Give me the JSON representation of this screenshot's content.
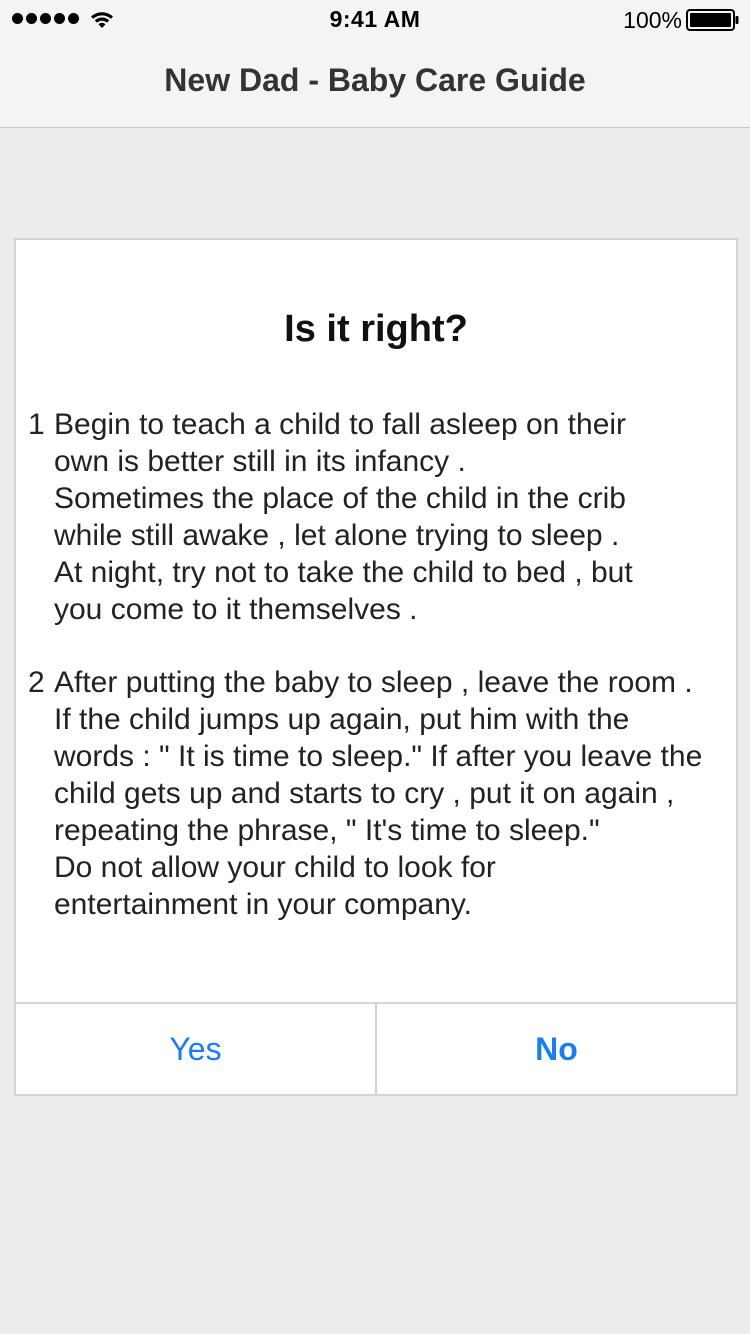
{
  "status_bar": {
    "time": "9:41 AM",
    "battery": "100%",
    "signal_icon": "signal-dots-icon",
    "wifi_icon": "wifi-icon",
    "battery_icon": "battery-icon"
  },
  "nav": {
    "title": "New Dad - Baby Care Guide"
  },
  "card": {
    "title": "Is it right?",
    "tips": [
      {
        "number": "1",
        "lines": [
          "Begin to teach a child to fall asleep on their",
          "own is better still in its infancy .",
          "Sometimes the place of the child in the crib",
          "while still awake , let alone trying to sleep .",
          "At night, try not to take the child to bed , but",
          "you come to it themselves ."
        ]
      },
      {
        "number": "2",
        "lines": [
          "After putting the baby to sleep , leave the room .",
          "If the child jumps up again, put him with the",
          "words : \" It is time to sleep.\" If after you leave the",
          "child gets up and starts to cry , put it on again ,",
          "repeating the phrase, \" It's time to sleep.\"",
          "Do not allow your child to look for",
          "entertainment in your company."
        ]
      }
    ],
    "actions": {
      "yes": "Yes",
      "no": "No"
    }
  },
  "colors": {
    "accent": "#1a7df0",
    "background": "#ececec",
    "bar": "#f4f4f4"
  }
}
